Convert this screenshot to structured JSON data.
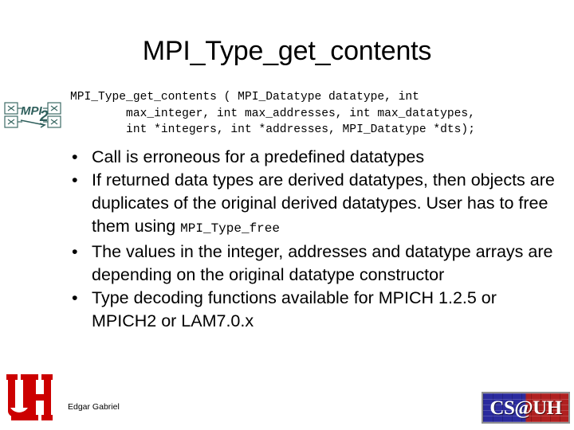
{
  "slide": {
    "title": "MPI_Type_get_contents",
    "background_color": "#ffffff",
    "text_color": "#000000"
  },
  "code": {
    "lines": [
      "MPI_Type_get_contents ( MPI_Datatype datatype, int",
      "        max_integer, int max_addresses, int max_datatypes,",
      "        int *integers, int *addresses, MPI_Datatype *dts);"
    ],
    "full_text": "MPI_Type_get_contents ( MPI_Datatype datatype, int\n        max_integer, int max_addresses, int max_datatypes,\n        int *integers, int *addresses, MPI_Datatype *dts);"
  },
  "bullets": [
    {
      "marker": "•",
      "text": "Call is erroneous for a predefined datatypes",
      "has_mono": false
    },
    {
      "marker": "•",
      "text_before": "If returned data types are derived datatypes, then objects are duplicates of the original derived datatypes. User has to free them using ",
      "mono": "MPI_Type_free",
      "text_after": "",
      "has_mono": true
    },
    {
      "marker": "•",
      "text": "The values in the integer, addresses and datatype arrays are depending on the original datatype constructor",
      "has_mono": false
    },
    {
      "marker": "•",
      "text": "Type decoding functions available for MPICH 1.2.5 or MPICH2 or LAM7.0.x",
      "has_mono": false
    }
  ],
  "footer": {
    "presenter": "Edgar Gabriel",
    "csuh_logo_text": "CS@UH",
    "csuh_blue": "#2b2b9e",
    "csuh_red": "#b02020",
    "uh_logo_color": "#cc0000",
    "mpi2_logo_text": "MPI-2",
    "mpi2_logo_color": "#2f5f5c"
  }
}
